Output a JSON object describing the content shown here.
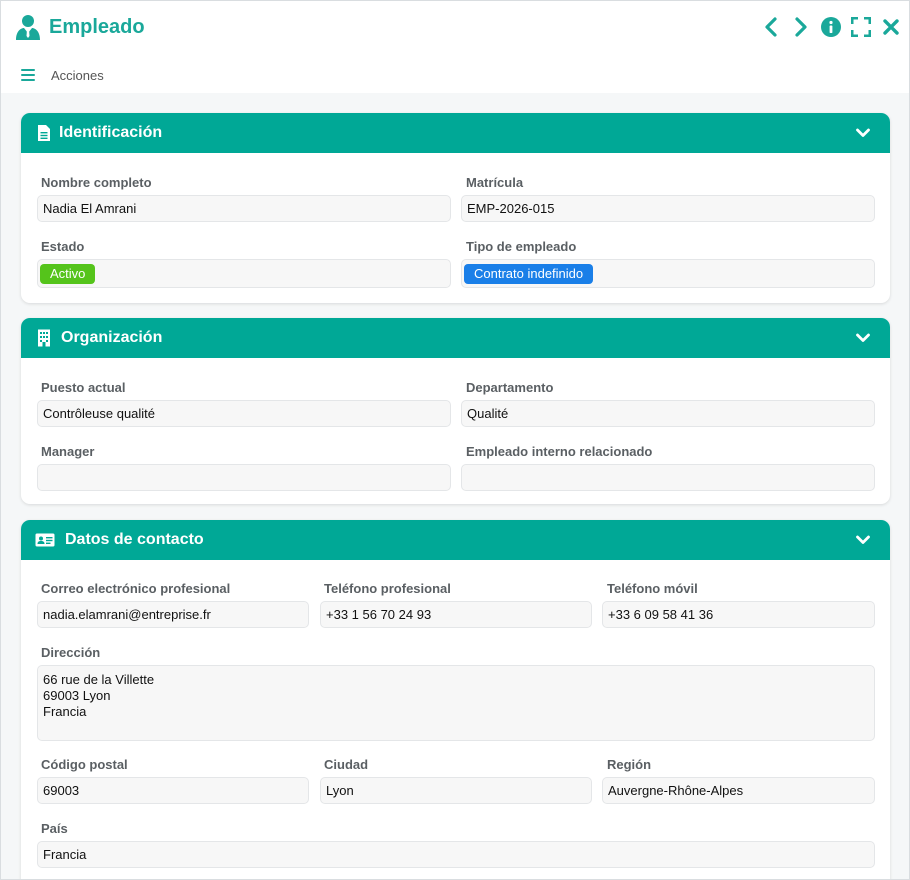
{
  "window": {
    "title": "Empleado",
    "menu_label": "Acciones",
    "accent_color": "#1aa89a"
  },
  "sections": {
    "identificacion": {
      "title": "Identificación",
      "icon": "document-icon",
      "fields": {
        "nombre": {
          "label": "Nombre completo",
          "value": "Nadia El Amrani"
        },
        "matricula": {
          "label": "Matrícula",
          "value": "EMP-2026-015"
        },
        "estado": {
          "label": "Estado",
          "value": "Activo",
          "color": "#55c41b"
        },
        "tipo": {
          "label": "Tipo de empleado",
          "value": "Contrato indefinido",
          "color": "#1a7fe8"
        }
      }
    },
    "organizacion": {
      "title": "Organización",
      "icon": "building-icon",
      "fields": {
        "puesto": {
          "label": "Puesto actual",
          "value": "Contrôleuse qualité"
        },
        "departamento": {
          "label": "Departamento",
          "value": "Qualité"
        },
        "manager": {
          "label": "Manager",
          "value": ""
        },
        "relacionado": {
          "label": "Empleado interno relacionado",
          "value": ""
        }
      }
    },
    "contacto": {
      "title": "Datos de contacto",
      "icon": "id-card-icon",
      "fields": {
        "correo": {
          "label": "Correo electrónico profesional",
          "value": "nadia.elamrani@entreprise.fr"
        },
        "tel_prof": {
          "label": "Teléfono profesional",
          "value": "+33 1 56 70 24 93"
        },
        "tel_movil": {
          "label": "Teléfono móvil",
          "value": "+33 6 09 58 41 36"
        },
        "direccion": {
          "label": "Dirección",
          "value": "66 rue de la Villette\n69003 Lyon\nFrancia"
        },
        "cp": {
          "label": "Código postal",
          "value": "69003"
        },
        "ciudad": {
          "label": "Ciudad",
          "value": "Lyon"
        },
        "region": {
          "label": "Región",
          "value": "Auvergne-Rhône-Alpes"
        },
        "pais": {
          "label": "País",
          "value": "Francia"
        }
      }
    }
  }
}
